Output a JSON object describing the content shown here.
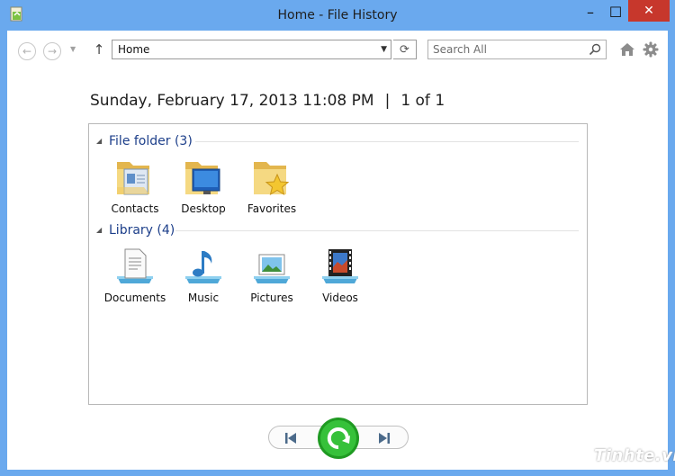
{
  "window": {
    "title": "Home - File History",
    "controls": {
      "minimize": "–",
      "maximize": "☐",
      "close": "✕"
    }
  },
  "toolbar": {
    "back": "←",
    "forward": "→",
    "history_drop": "▼",
    "up": "↑",
    "address": "Home",
    "address_drop": "▼",
    "refresh": "⟳",
    "search_placeholder": "Search All"
  },
  "snapshot": {
    "date": "Sunday, February 17, 2013 11:08 PM",
    "separator": "|",
    "position": "1 of 1"
  },
  "groups": [
    {
      "label": "File folder (3)",
      "items": [
        {
          "label": "Contacts",
          "icon": "contacts-folder-icon"
        },
        {
          "label": "Desktop",
          "icon": "desktop-folder-icon"
        },
        {
          "label": "Favorites",
          "icon": "favorites-folder-icon"
        }
      ]
    },
    {
      "label": "Library (4)",
      "items": [
        {
          "label": "Documents",
          "icon": "documents-library-icon"
        },
        {
          "label": "Music",
          "icon": "music-library-icon"
        },
        {
          "label": "Pictures",
          "icon": "pictures-library-icon"
        },
        {
          "label": "Videos",
          "icon": "videos-library-icon"
        }
      ]
    }
  ],
  "watermark": "Tinhte.vn",
  "colors": {
    "titlebar": "#6aa9ee",
    "close": "#c7372c",
    "group_text": "#1d3f8a",
    "restore_green": "#2fb52c"
  }
}
